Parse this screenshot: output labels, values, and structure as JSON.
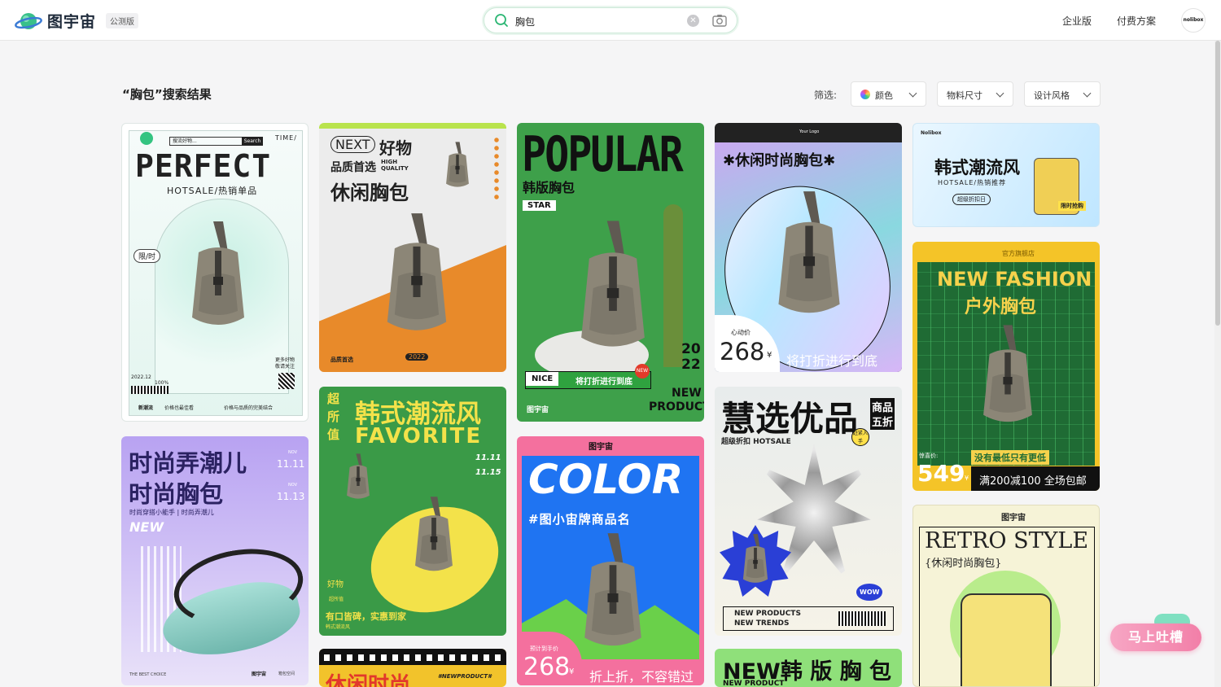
{
  "header": {
    "logo_name": "图宇宙",
    "badge": "公测版",
    "search_value": "胸包",
    "links": [
      "企业版",
      "付费方案"
    ],
    "avatar_text": "nolibox"
  },
  "results": {
    "title": "“胸包”搜索结果",
    "filter_label": "筛选:",
    "filters": [
      "颜色",
      "物料尺寸",
      "设计风格"
    ]
  },
  "cards": {
    "c1": {
      "logo_search": "搜流好物...",
      "search_btn": "Search",
      "time": "TIME/",
      "headline": "PERFECT",
      "sub": "HOTSALE/热销单品",
      "tag": "限/时",
      "date": "2022.12",
      "pct": "100%",
      "side": "更多好物 敬请关注",
      "foot1": "新潮流",
      "foot2": "价格也最佳看",
      "foot3": "价格与品质的完美结合"
    },
    "c2": {
      "next": "NEXT",
      "haowu": "好物",
      "line1": "品质首选",
      "high": "HIGH QUALITY",
      "line2": "休闲胸包",
      "foot": "品质首选",
      "year": "2022"
    },
    "c3": {
      "headline": "POPULAR",
      "sub": "韩版胸包",
      "star": "STAR",
      "nice": "NICE",
      "promo": "将打折进行到底",
      "new_badge": "NEW",
      "year_top": "20",
      "year_bot": "22",
      "new": "NEW",
      "product": "PRODUCT",
      "brand": "图宇宙"
    },
    "c4": {
      "your_logo": "Your Logo",
      "headline": "✱休闲时尚胸包✱",
      "heart": "心动价",
      "price": "268",
      "yen": "¥",
      "promo": "将打折进行到底"
    },
    "c5": {
      "brand": "Nolibox",
      "headline": "韩式潮流风",
      "sub": "HOTSALE/热销推荐",
      "badge": "超级折扣日",
      "tag": "限时抢购"
    },
    "c6": {
      "top": "官方旗舰店",
      "l1": "NEW FASHION",
      "l2": "户外胸包",
      "pre": "惊喜价:",
      "price": "549",
      "yen": "¥",
      "chip": "没有最低只有更低",
      "promo": "满200减100 全场包邮"
    },
    "c7": {
      "l1": "时尚弄潮儿",
      "l2": "时尚胸包",
      "sub": "时尚穿搭小能手 | 时尚弄潮儿",
      "new": "NEW",
      "nov1": "NOV",
      "d1": "11.11",
      "nov2": "NOV",
      "d2": "11.13",
      "foot": "THE BEST CHOICE",
      "brand": "图宇宙",
      "foot2": "箱包空间"
    },
    "c8": {
      "side": "超所值",
      "l1": "韩式潮流风",
      "l2": "FAVORITE",
      "d1": "11.11",
      "d2": "11.15",
      "tag1": "好物",
      "tag2": "超所值",
      "foot": "有口皆碑，实惠到家",
      "foot2": "韩式潮流风"
    },
    "c9": {
      "brand": "图宇宙",
      "headline": "COLOR",
      "sub": "#图小宙牌商品名",
      "pre": "预计到手价",
      "price": "268",
      "yen": "¥",
      "promo": "折上折，不容错过"
    },
    "c10": {
      "l1": "慧选优品",
      "tag1": "商品",
      "tag2": "五折",
      "sub": "超级折扣 HOTSALE",
      "badge": "赶紧入手",
      "wow": "WOW",
      "foot1": "NEW PRODUCTS",
      "foot2": "NEW TRENDS"
    },
    "c11": {
      "brand": "图宇宙",
      "headline": "RETRO STYLE",
      "sub": "{休闲时尚胸包}"
    },
    "c12": {
      "text": "休闲时尚",
      "sub": "#NEWPRODUCT#"
    },
    "c13": {
      "text": "NEW韩 版 胸 包",
      "sub": "NEW PRODUCT"
    }
  },
  "feedback": {
    "label": "马上吐槽"
  }
}
